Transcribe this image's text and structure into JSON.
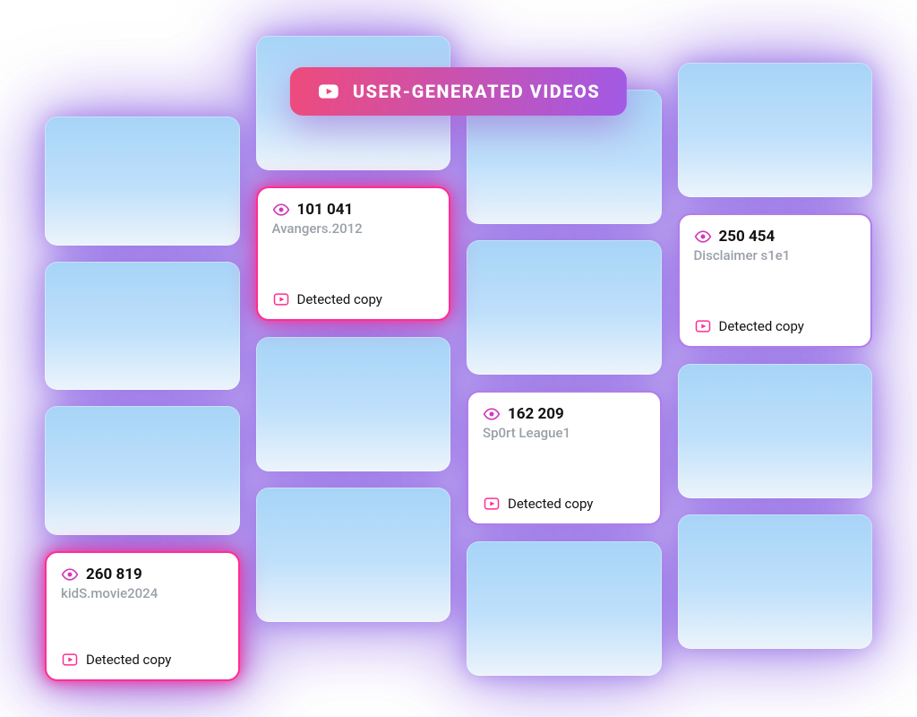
{
  "header": {
    "label": "USER-GENERATED VIDEOS"
  },
  "detected_label": "Detected copy",
  "cards": {
    "avangers": {
      "views": "101 041",
      "title": "Avangers.2012"
    },
    "disclaimer": {
      "views": "250 454",
      "title": "Disclaimer s1e1"
    },
    "sport": {
      "views": "162 209",
      "title": "Sp0rt League1"
    },
    "kids": {
      "views": "260 819",
      "title": "kidS.movie2024"
    }
  }
}
